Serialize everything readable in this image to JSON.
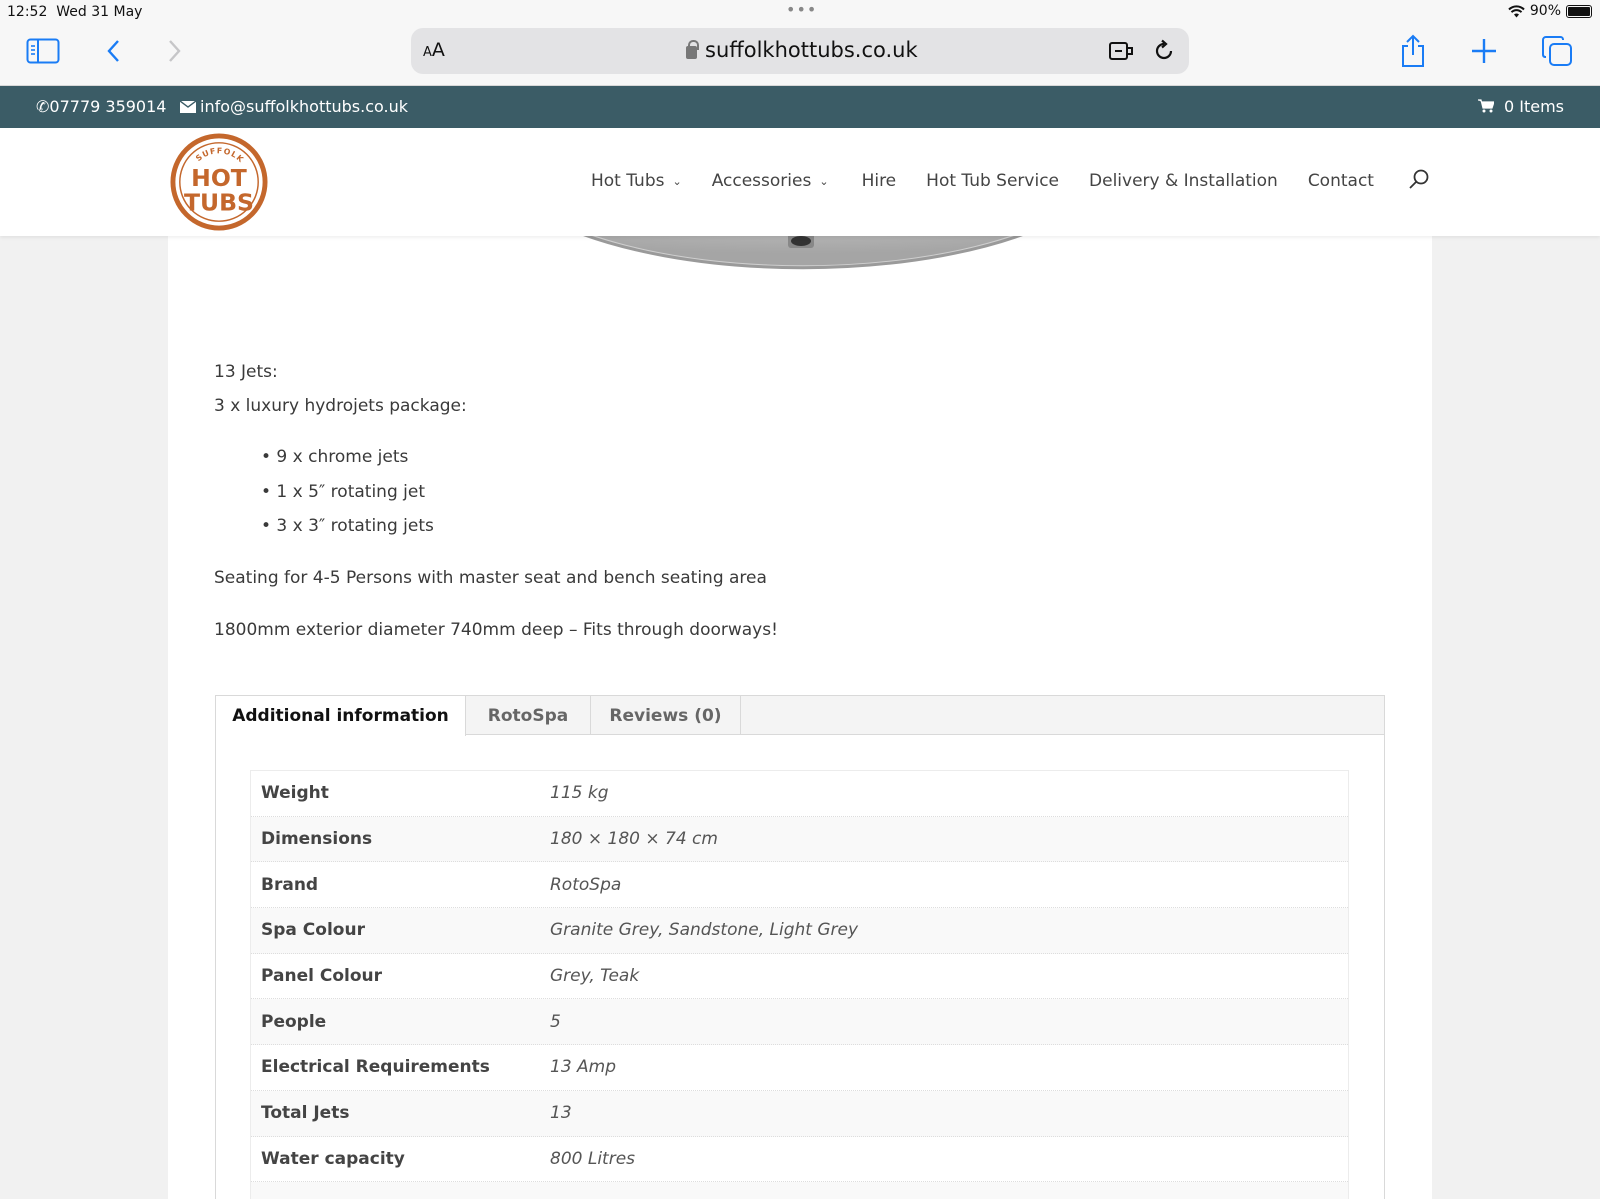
{
  "statusbar": {
    "time": "12:52",
    "date": "Wed 31 May",
    "battery": "90%"
  },
  "browser": {
    "aa_small": "A",
    "aa_big": "A",
    "url": "suffolkhottubs.co.uk"
  },
  "topbar": {
    "phone": "07779 359014",
    "email": "info@suffolkhottubs.co.uk",
    "cart": "0 Items"
  },
  "logo": {
    "top": "SUFFOLK",
    "line1": "HOT",
    "line2": "TUBS"
  },
  "nav": {
    "items": [
      {
        "label": "Hot Tubs",
        "dropdown": true
      },
      {
        "label": "Accessories",
        "dropdown": true
      },
      {
        "label": "Hire",
        "dropdown": false
      },
      {
        "label": "Hot Tub Service",
        "dropdown": false
      },
      {
        "label": "Delivery & Installation",
        "dropdown": false
      },
      {
        "label": "Contact",
        "dropdown": false
      }
    ]
  },
  "content": {
    "jets_heading": "13 Jets:",
    "package": "3 x luxury hydrojets package:",
    "bullets": [
      "• 9 x chrome jets",
      "• 1 x 5″ rotating jet",
      "• 3 x 3″ rotating jets"
    ],
    "seating": "Seating for 4-5 Persons with master seat and bench seating area",
    "size": "1800mm exterior diameter 740mm deep – Fits through doorways!"
  },
  "tabs": [
    "Additional information",
    "RotoSpa",
    "Reviews (0)"
  ],
  "attributes": [
    {
      "key": "Weight",
      "value": "115 kg"
    },
    {
      "key": "Dimensions",
      "value": "180 × 180 × 74 cm"
    },
    {
      "key": "Brand",
      "value": "RotoSpa"
    },
    {
      "key": "Spa Colour",
      "value": "Granite Grey, Sandstone, Light Grey"
    },
    {
      "key": "Panel Colour",
      "value": "Grey, Teak"
    },
    {
      "key": "People",
      "value": "5"
    },
    {
      "key": "Electrical Requirements",
      "value": "13 Amp"
    },
    {
      "key": "Total Jets",
      "value": "13"
    },
    {
      "key": "Water capacity",
      "value": "800 Litres"
    }
  ],
  "colors": {
    "topbar": "#3b5c66",
    "logo": "#c4672c",
    "safari_blue": "#1a7cf5"
  }
}
